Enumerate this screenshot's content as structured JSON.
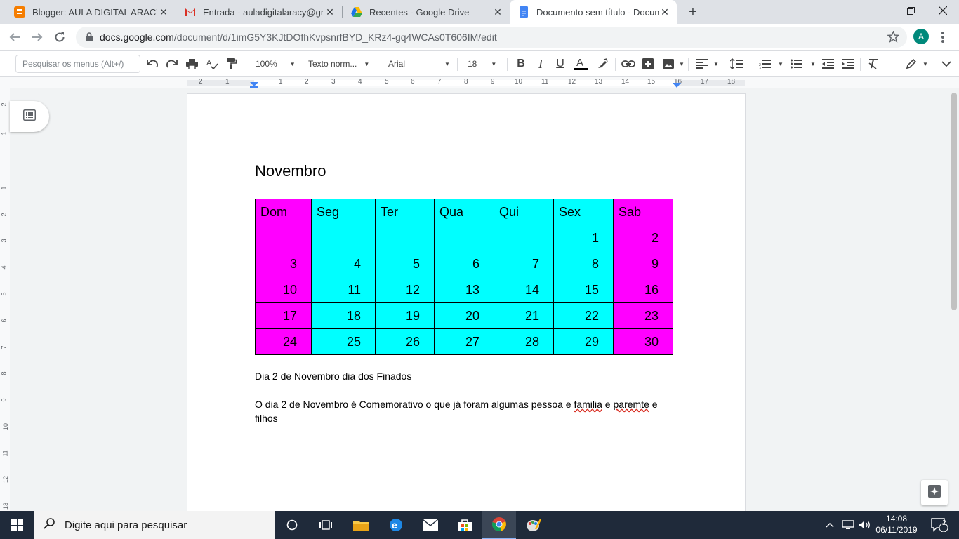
{
  "browser": {
    "tabs": [
      {
        "title": "Blogger: AULA DIGITAL ARACY - (",
        "icon": "blogger-icon",
        "close": "✕"
      },
      {
        "title": "Entrada - auladigitalaracy@gmail",
        "icon": "gmail-icon",
        "close": "✕"
      },
      {
        "title": "Recentes - Google Drive",
        "icon": "drive-icon",
        "close": "✕"
      },
      {
        "title": "Documento sem título - Docume",
        "icon": "docs-icon",
        "close": "✕"
      }
    ],
    "new_tab": "+",
    "url_domain": "docs.google.com",
    "url_path": "/document/d/1imG5Y3KJtDOfhKvpsnrfBYD_KRz4-gq4WCAs0T606IM/edit",
    "profile_initial": "A"
  },
  "toolbar": {
    "search_placeholder": "Pesquisar os menus (Alt+/)",
    "zoom": "100%",
    "style": "Texto norm...",
    "font": "Arial",
    "size": "18"
  },
  "ruler": {
    "h": [
      "2",
      "1",
      "1",
      "2",
      "3",
      "4",
      "5",
      "6",
      "7",
      "8",
      "9",
      "10",
      "11",
      "12",
      "13",
      "14",
      "15",
      "16",
      "17",
      "18"
    ],
    "v": [
      "2",
      "1",
      "1",
      "2",
      "3",
      "4",
      "5",
      "6",
      "7",
      "8",
      "9",
      "10",
      "11",
      "12",
      "13"
    ]
  },
  "document": {
    "title": "Novembro",
    "colors": {
      "weekend": "#ff00ff",
      "weekday": "#00ffff"
    },
    "calendar": {
      "header": [
        "Dom",
        "Seg",
        "Ter",
        "Qua",
        "Qui",
        "Sex",
        "Sab"
      ],
      "rows": [
        [
          "",
          "",
          "",
          "",
          "",
          "1",
          "2"
        ],
        [
          "3",
          "4",
          "5",
          "6",
          "7",
          "8",
          "9"
        ],
        [
          "10",
          "11",
          "12",
          "13",
          "14",
          "15",
          "16"
        ],
        [
          "17",
          "18",
          "19",
          "20",
          "21",
          "22",
          "23"
        ],
        [
          "24",
          "25",
          "26",
          "27",
          "28",
          "29",
          "30"
        ]
      ]
    },
    "para1": "Dia 2 de Novembro dia dos Finados",
    "para2_a": "O dia 2 de Novembro é Comemorativo o que já foram algumas pessoa e ",
    "para2_b": "familia",
    "para2_c": " e ",
    "para2_d": "paremte",
    "para2_e": " e",
    "para2_line2": "filhos"
  },
  "taskbar": {
    "search_text": "Digite aqui para pesquisar",
    "time": "14:08",
    "date": "06/11/2019",
    "notif_count": "2"
  }
}
